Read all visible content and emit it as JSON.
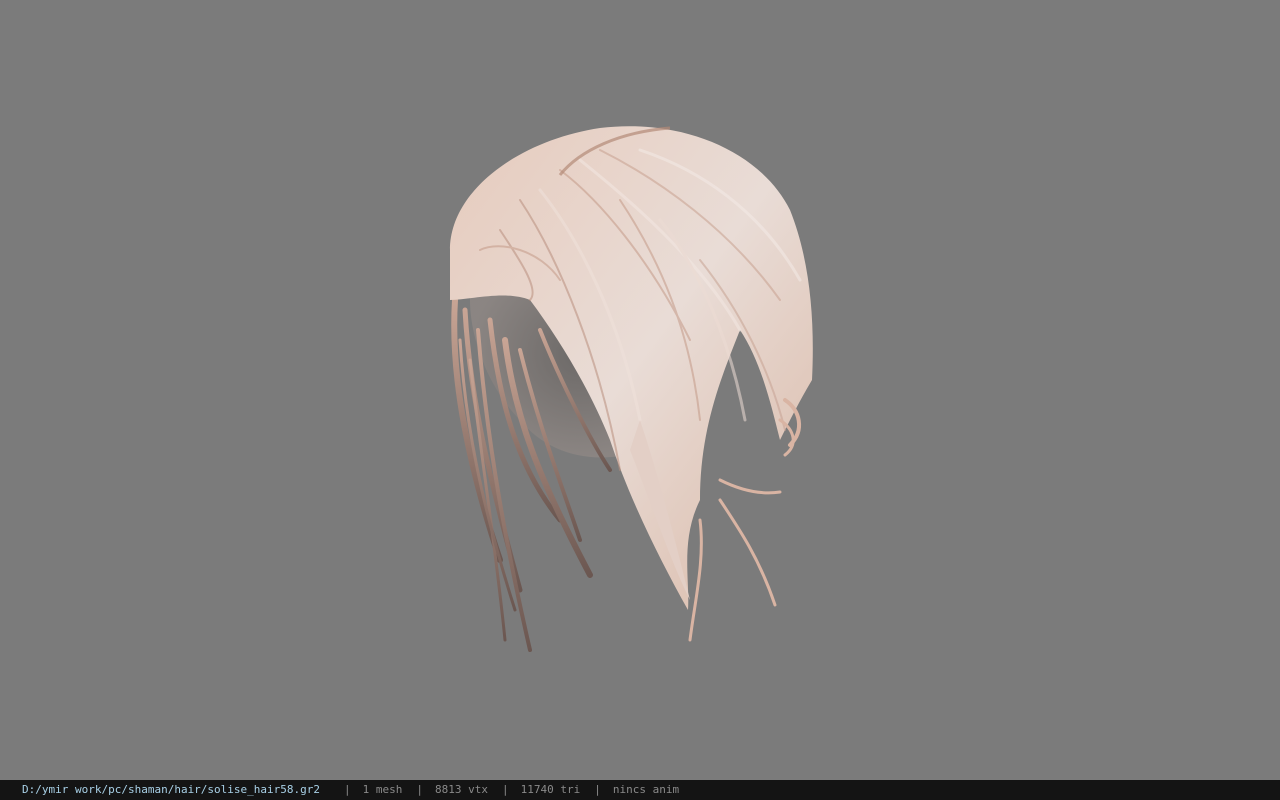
{
  "viewer": {
    "background_color": "#7b7b7b",
    "model": {
      "subject": "hair mesh",
      "color_light": "#e9d6cd",
      "color_mid": "#d6b3a2",
      "color_dark": "#6e5a52"
    }
  },
  "status_bar": {
    "file_path": "D:/ymir work/pc/shaman/hair/solise_hair58.gr2",
    "mesh_count": "1 mesh",
    "vertex_count": "8813 vtx",
    "triangle_count": "11740 tri",
    "anim_status": "nincs anim",
    "separator": "|",
    "path_color": "#a8d0e6",
    "text_color": "#8a8a8a",
    "background_color": "#141414"
  }
}
